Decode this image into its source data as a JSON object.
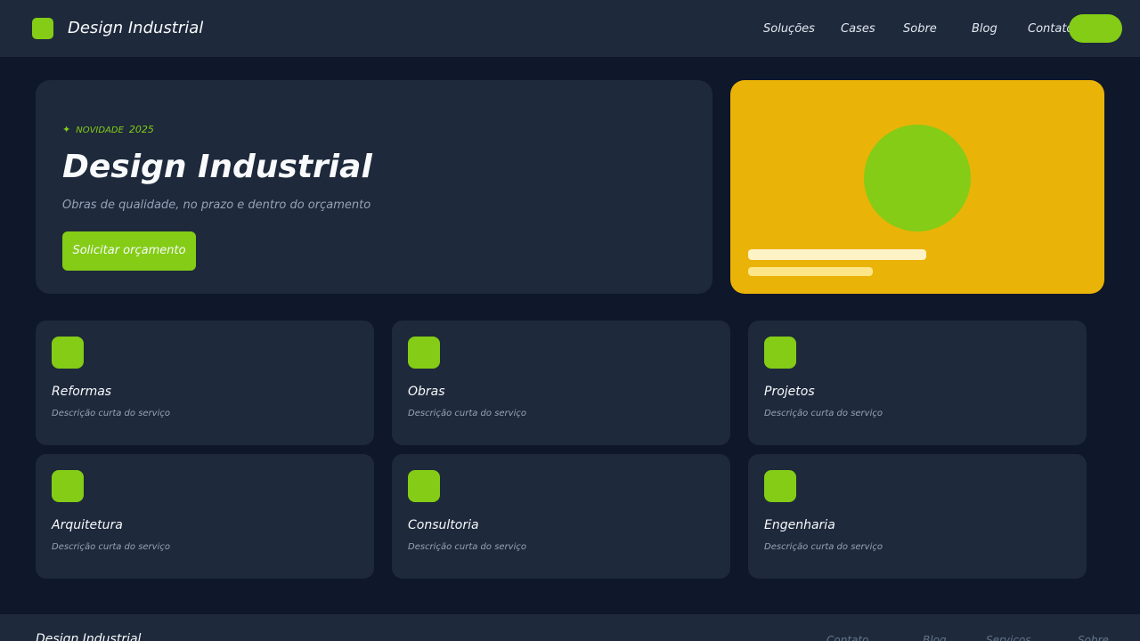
{
  "header": {
    "brand": "Design Industrial",
    "nav": [
      "Soluções",
      "Cases",
      "Sobre",
      "Blog",
      "Contato"
    ]
  },
  "hero": {
    "badge_label": "NOVIDADE",
    "badge_year": "2025",
    "title": "Design Industrial",
    "subtitle": "Obras de qualidade, no prazo e dentro do orçamento",
    "cta": "Solicitar orçamento"
  },
  "services": [
    {
      "title": "Reformas",
      "description": "Descrição curta do serviço"
    },
    {
      "title": "Obras",
      "description": "Descrição curta do serviço"
    },
    {
      "title": "Projetos",
      "description": "Descrição curta do serviço"
    },
    {
      "title": "Arquitetura",
      "description": "Descrição curta do serviço"
    },
    {
      "title": "Consultoria",
      "description": "Descrição curta do serviço"
    },
    {
      "title": "Engenharia",
      "description": "Descrição curta do serviço"
    }
  ],
  "footer": {
    "brand": "Design Industrial",
    "links": [
      "Contato",
      "Blog",
      "Serviços",
      "Sobre"
    ]
  },
  "colors": {
    "background": "#0f172a",
    "surface": "#1e293b",
    "accent": "#84cc16",
    "highlight": "#eab308"
  },
  "icons": {
    "badge": "sparkle-icon",
    "brand": "logo-mark",
    "service": "service-icon"
  }
}
